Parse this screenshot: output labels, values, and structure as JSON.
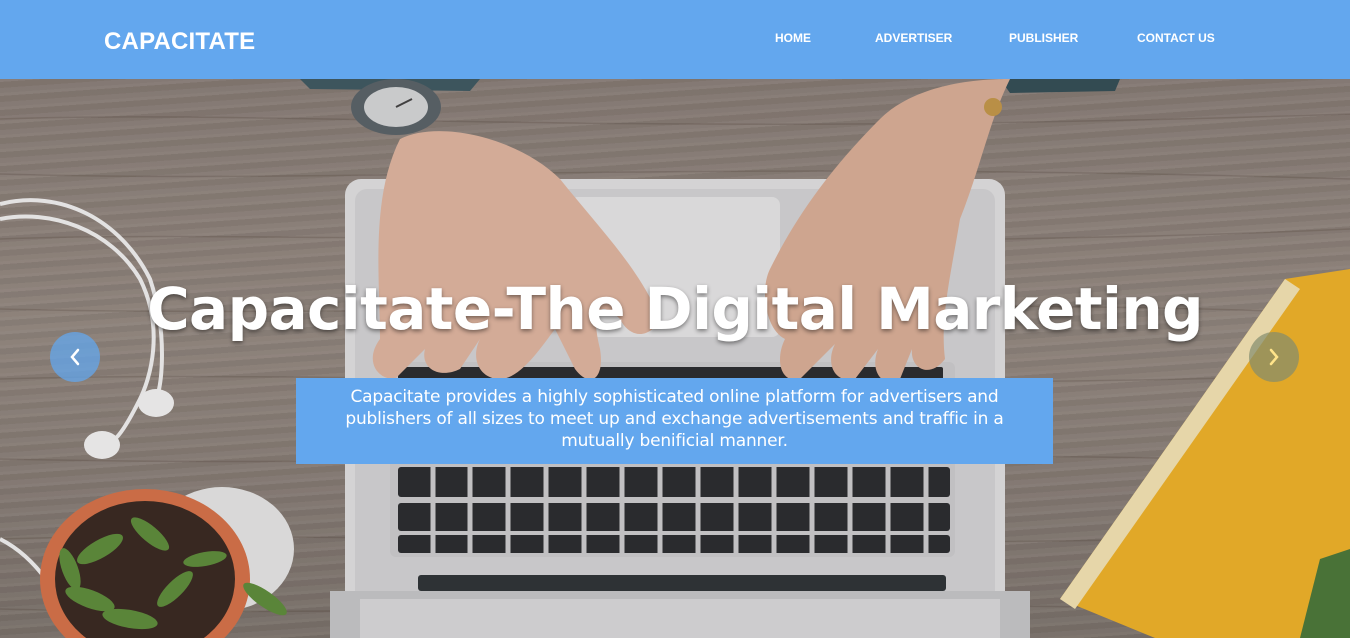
{
  "navbar": {
    "brand": "CAPACITATE",
    "links": [
      {
        "label": "HOME"
      },
      {
        "label": "ADVERTISER"
      },
      {
        "label": "PUBLISHER"
      },
      {
        "label": "CONTACT US"
      }
    ]
  },
  "hero": {
    "title": "Capacitate-The Digital Marketing",
    "caption": "Capacitate provides a highly sophisticated online platform for advertisers and publishers of all sizes to meet up and exchange advertisements and traffic in a mutually benificial manner."
  },
  "carousel": {
    "prev_icon": "chevron-left-icon",
    "next_icon": "chevron-right-icon"
  },
  "colors": {
    "nav_bg": "#63a7ee",
    "caption_bg": "#63a7ee",
    "text": "#ffffff",
    "book_yellow": "#f3b92c"
  }
}
